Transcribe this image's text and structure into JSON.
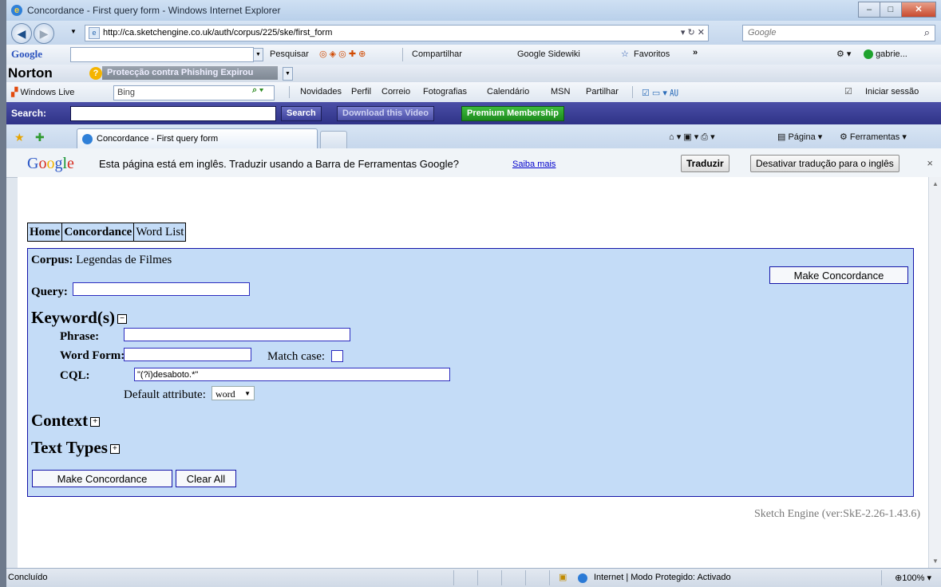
{
  "window": {
    "title": "Concordance - First query form - Windows Internet Explorer"
  },
  "address": {
    "url": "http://ca.sketchengine.co.uk/auth/corpus/225/ske/first_form",
    "search_placeholder": "Google"
  },
  "google_toolbar": {
    "logo": "Google",
    "search_label": "Pesquisar",
    "share_label": "Compartilhar",
    "sidewiki_label": "Google Sidewiki",
    "favorites_label": "Favoritos",
    "more": "»",
    "user": "gabrie..."
  },
  "norton": {
    "logo": "Norton",
    "status": "Protecção contra Phishing Expirou"
  },
  "live_toolbar": {
    "logo": "Windows Live",
    "search_value": "Bing",
    "links": [
      "Novidades",
      "Perfil",
      "Correio",
      "Fotografias",
      "Calendário",
      "MSN",
      "Partilhar"
    ],
    "signin": "Iniciar sessão"
  },
  "video_toolbar": {
    "search_label": "Search:",
    "search_button": "Search",
    "download_button": "Download this Video",
    "premium_button": "Premium Membership"
  },
  "tabs": {
    "active": "Concordance - First query form",
    "command_page": "Página",
    "command_tools": "Ferramentas"
  },
  "translate_bar": {
    "logo": "Google",
    "message": "Esta página está em inglês.  Traduzir usando a Barra de Ferramentas Google?",
    "learn_more": "Saiba mais",
    "translate_button": "Traduzir",
    "disable_button": "Desativar tradução para o inglês",
    "close": "×"
  },
  "menu": {
    "home": "Home",
    "concordance": "Concordance",
    "wordlist": "Word List"
  },
  "form": {
    "corpus_label": "Corpus:",
    "corpus_value": "Legendas de Filmes",
    "make_button_top": "Make Concordance",
    "query_label": "Query:",
    "keywords_heading": "Keyword(s)",
    "phrase_label": "Phrase:",
    "wordform_label": "Word Form:",
    "matchcase_label": "Match case:",
    "cql_label": "CQL:",
    "cql_value": "\"(?i)desaboto.*\"",
    "default_attr_label": "Default attribute:",
    "default_attr_value": "word",
    "context_heading": "Context",
    "texttypes_heading": "Text Types",
    "make_button_bottom": "Make Concordance",
    "clear_button": "Clear All"
  },
  "footer": {
    "version": "Sketch Engine (ver:SkE-2.26-1.43.6)"
  },
  "status": {
    "text": "Concluído",
    "zone": "Internet | Modo Protegido: Activado",
    "zoom": "100%"
  }
}
